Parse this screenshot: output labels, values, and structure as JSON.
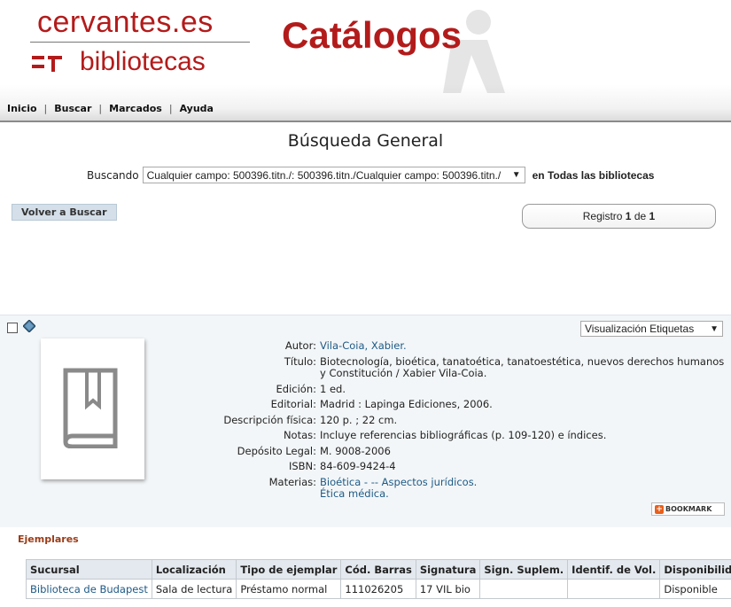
{
  "header": {
    "logo_top": "cervantes.es",
    "logo_bottom": "bibliotecas",
    "title": "Catálogos",
    "nav": [
      "Inicio",
      "Buscar",
      "Marcados",
      "Ayuda"
    ]
  },
  "search": {
    "page_title": "Búsqueda General",
    "label": "Buscando",
    "query": "Cualquier campo: 500396.titn./: 500396.titn./Cualquier campo: 500396.titn./",
    "scope": "en Todas las bibliotecas",
    "back_button": "Volver a Buscar",
    "record_label": "Registro",
    "record_current": "1",
    "record_of": "de",
    "record_total": "1"
  },
  "record": {
    "view_select": "Visualización Etiquetas",
    "fields": {
      "autor_k": "Autor:",
      "autor_v": "Vila-Coia, Xabier.",
      "titulo_k": "Título:",
      "titulo_v": "Biotecnología, bioética, tanatoética, tanatoestética, nuevos derechos humanos y Constitución / Xabier Vila-Coia.",
      "edicion_k": "Edición:",
      "edicion_v": "1 ed.",
      "editorial_k": "Editorial:",
      "editorial_v": "Madrid : Lapinga Ediciones, 2006.",
      "desc_k": "Descripción física:",
      "desc_v": "120 p. ; 22 cm.",
      "notas_k": "Notas:",
      "notas_v": "Incluye referencias bibliográficas (p. 109-120) e índices.",
      "deposito_k": "Depósito Legal:",
      "deposito_v": "M. 9008-2006",
      "isbn_k": "ISBN:",
      "isbn_v": "84-609-9424-4",
      "materias_k": "Materias:",
      "materias_v1": "Bioética - -- Aspectos jurídicos.",
      "materias_v2": "Ética médica."
    },
    "bookmark": "BOOKMARK"
  },
  "copies": {
    "title": "Ejemplares",
    "headers": [
      "Sucursal",
      "Localización",
      "Tipo de ejemplar",
      "Cód. Barras",
      "Signatura",
      "Sign. Suplem.",
      "Identif. de Vol.",
      "Disponibilidad"
    ],
    "rows": [
      [
        "Biblioteca de Budapest",
        "Sala de lectura",
        "Préstamo normal",
        "111026205",
        "17 VIL bio",
        "",
        "",
        "Disponible"
      ]
    ]
  },
  "colors": {
    "brand_red": "#b31b1b",
    "link_blue": "#1d5a86",
    "section_brown": "#9b3b16"
  }
}
